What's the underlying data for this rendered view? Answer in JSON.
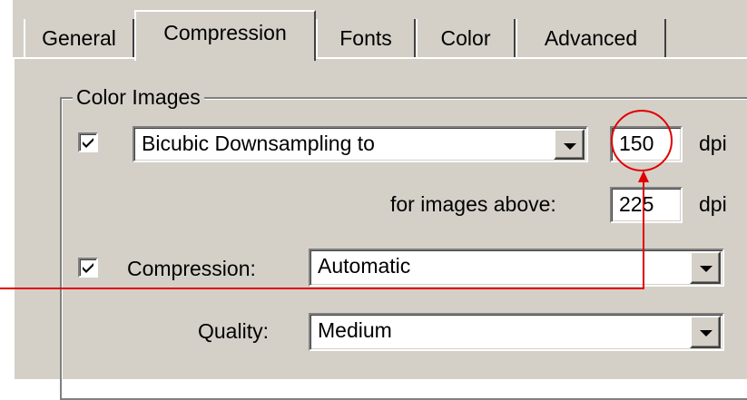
{
  "tabs": [
    "General",
    "Compression",
    "Fonts",
    "Color",
    "Advanced"
  ],
  "active_tab": "Compression",
  "group": {
    "title": "Color Images",
    "downsampling": {
      "checked": true,
      "method": "Bicubic Downsampling to",
      "dpi_value": "150",
      "dpi_unit": "dpi",
      "above_label": "for images above:",
      "above_value": "225",
      "above_unit": "dpi"
    },
    "compression": {
      "checked": true,
      "label": "Compression:",
      "value": "Automatic"
    },
    "quality": {
      "label": "Quality:",
      "value": "Medium"
    }
  },
  "colors": {
    "dialog_face": "#d4d0c8",
    "annotation": "#e00000"
  },
  "icons": [
    "checkmark-icon",
    "dropdown-arrow-icon"
  ]
}
